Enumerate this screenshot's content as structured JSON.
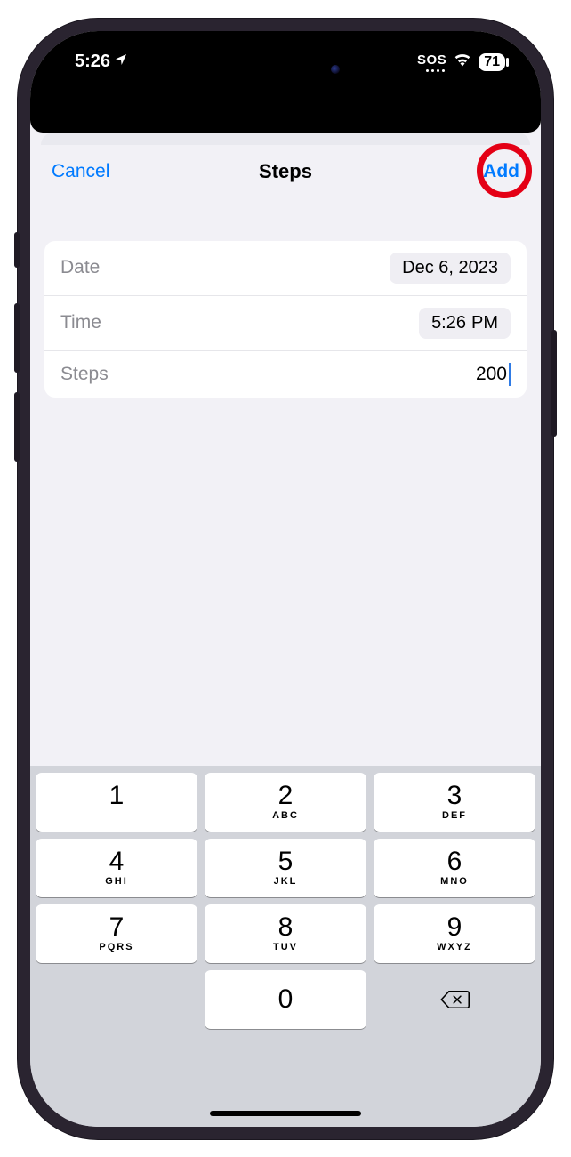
{
  "statusbar": {
    "time": "5:26",
    "sos": "SOS",
    "battery": "71"
  },
  "nav": {
    "cancel": "Cancel",
    "title": "Steps",
    "add": "Add"
  },
  "form": {
    "date_label": "Date",
    "date_value": "Dec 6, 2023",
    "time_label": "Time",
    "time_value": "5:26",
    "time_ampm": "PM",
    "steps_label": "Steps",
    "steps_value": "200"
  },
  "keypad": {
    "keys": [
      {
        "num": "1",
        "sub": ""
      },
      {
        "num": "2",
        "sub": "ABC"
      },
      {
        "num": "3",
        "sub": "DEF"
      },
      {
        "num": "4",
        "sub": "GHI"
      },
      {
        "num": "5",
        "sub": "JKL"
      },
      {
        "num": "6",
        "sub": "MNO"
      },
      {
        "num": "7",
        "sub": "PQRS"
      },
      {
        "num": "8",
        "sub": "TUV"
      },
      {
        "num": "9",
        "sub": "WXYZ"
      }
    ],
    "zero": "0"
  }
}
